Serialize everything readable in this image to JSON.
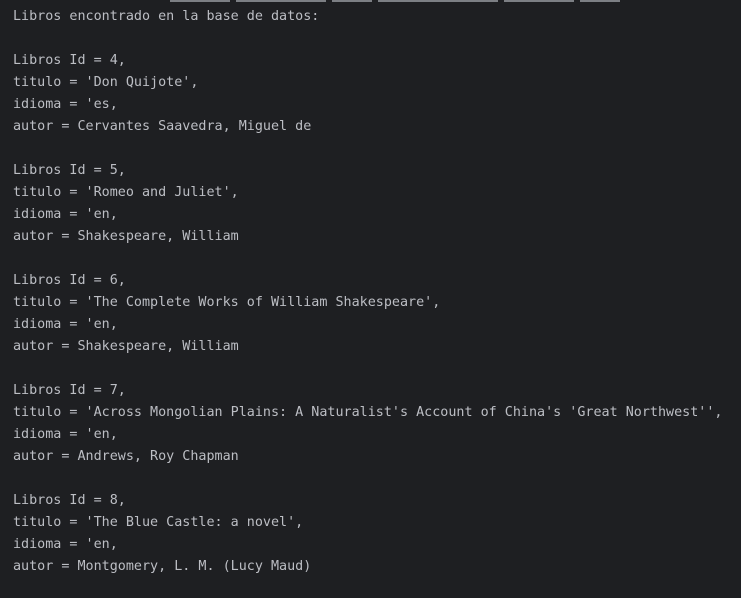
{
  "console": {
    "header": "Libros encontrado en la base de datos:",
    "records": [
      {
        "id_line": "Libros Id = 4,",
        "titulo_line": "titulo = 'Don Quijote',",
        "idioma_line": "idioma = 'es,",
        "autor_line": "autor = Cervantes Saavedra, Miguel de"
      },
      {
        "id_line": "Libros Id = 5,",
        "titulo_line": "titulo = 'Romeo and Juliet',",
        "idioma_line": "idioma = 'en,",
        "autor_line": "autor = Shakespeare, William"
      },
      {
        "id_line": "Libros Id = 6,",
        "titulo_line": "titulo = 'The Complete Works of William Shakespeare',",
        "idioma_line": "idioma = 'en,",
        "autor_line": "autor = Shakespeare, William"
      },
      {
        "id_line": "Libros Id = 7,",
        "titulo_line": "titulo = 'Across Mongolian Plains: A Naturalist's Account of China's 'Great Northwest'',",
        "idioma_line": "idioma = 'en,",
        "autor_line": "autor = Andrews, Roy Chapman"
      },
      {
        "id_line": "Libros Id = 8,",
        "titulo_line": "titulo = 'The Blue Castle: a novel',",
        "idioma_line": "idioma = 'en,",
        "autor_line": "autor = Montgomery, L. M. (Lucy Maud)"
      }
    ]
  },
  "colors": {
    "background": "#1e1f22",
    "text": "#bcbec4"
  }
}
